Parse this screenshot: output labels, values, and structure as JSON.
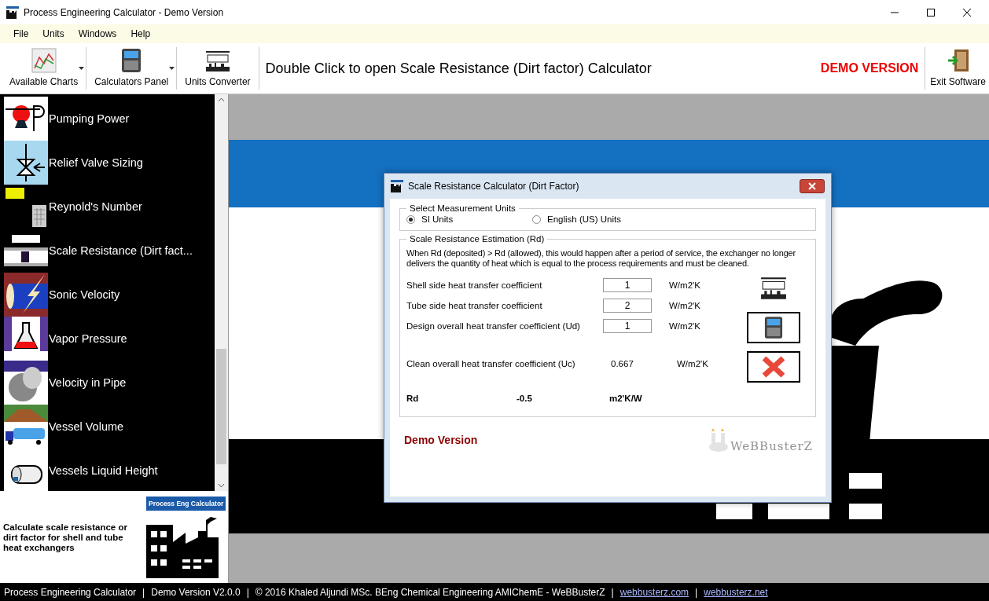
{
  "window": {
    "title": "Process Engineering Calculator - Demo Version"
  },
  "menu": [
    "File",
    "Units",
    "Windows",
    "Help"
  ],
  "toolbar": {
    "buttons": [
      {
        "label": "Available Charts",
        "dropdown": true
      },
      {
        "label": "Calculators Panel",
        "dropdown": true
      },
      {
        "label": "Units Converter",
        "dropdown": false
      }
    ],
    "hint": "Double Click to open Scale Resistance (Dirt factor) Calculator",
    "demo": "DEMO VERSION",
    "exit": {
      "label": "Exit Software"
    }
  },
  "sidebar": {
    "items": [
      {
        "label": "Pumping Power"
      },
      {
        "label": "Relief Valve Sizing"
      },
      {
        "label": "Reynold's Number"
      },
      {
        "label": "Scale Resistance (Dirt fact..."
      },
      {
        "label": "Sonic Velocity"
      },
      {
        "label": "Vapor Pressure"
      },
      {
        "label": "Velocity in Pipe"
      },
      {
        "label": "Vessel Volume"
      },
      {
        "label": "Vessels Liquid Height"
      }
    ],
    "description": "Calculate scale resistance or dirt factor for shell and tube heat exchangers",
    "logo": "Process Eng Calculator"
  },
  "dialog": {
    "title": "Scale Resistance Calculator (Dirt Factor)",
    "units": {
      "legend": "Select Measurement Units",
      "options": [
        {
          "label": "SI Units",
          "selected": true
        },
        {
          "label": "English (US) Units",
          "selected": false
        }
      ]
    },
    "estimation": {
      "legend": "Scale Resistance Estimation (Rd)",
      "description": "When Rd (deposited) > Rd (allowed), this would happen after a period of service, the exchanger no longer delivers the quantity of heat which is equal to the process requirements and must be cleaned.",
      "inputs": [
        {
          "label": "Shell side heat transfer coefficient",
          "value": "1",
          "unit": "W/m2'K"
        },
        {
          "label": "Tube side heat transfer coefficient",
          "value": "2",
          "unit": "W/m2'K"
        },
        {
          "label": "Design overall heat transfer coefficient (Ud)",
          "value": "1",
          "unit": "W/m2'K"
        }
      ],
      "clean": {
        "label": "Clean overall heat transfer coefficient (Uc)",
        "value": "0.667",
        "unit": "W/m2'K"
      },
      "rd": {
        "label": "Rd",
        "value": "-0.5",
        "unit": "m2'K/W"
      }
    },
    "footer": "Demo Version",
    "brand": "WeBBusterZ"
  },
  "status_bar": [
    {
      "kind": "text",
      "text": "Process Engineering Calculator"
    },
    {
      "kind": "sep",
      "text": "|"
    },
    {
      "kind": "text",
      "text": "Demo Version V2.0.0"
    },
    {
      "kind": "sep",
      "text": "|"
    },
    {
      "kind": "text",
      "text": "© 2016 Khaled Aljundi MSc. BEng Chemical Engineering AMIChemE - WeBBusterZ"
    },
    {
      "kind": "sep",
      "text": "|"
    },
    {
      "kind": "link",
      "text": "webbusterz.com"
    },
    {
      "kind": "sep",
      "text": "|"
    },
    {
      "kind": "link",
      "text": "webbusterz.net"
    }
  ]
}
